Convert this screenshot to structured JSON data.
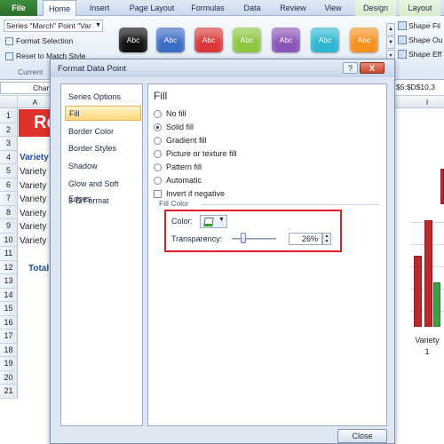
{
  "ribbon": {
    "tabs": [
      "File",
      "Home",
      "Insert",
      "Page Layout",
      "Formulas",
      "Data",
      "Review",
      "View",
      "Design",
      "Layout"
    ],
    "series_selector": "Series \"March\" Point \"Var",
    "format_selection": "Format Selection",
    "reset_to_match_style": "Reset to Match Style",
    "group_label": "Current",
    "style_swatches": [
      {
        "label": "Abc",
        "color": "#111111"
      },
      {
        "label": "Abc",
        "color": "#3b6cc4"
      },
      {
        "label": "Abc",
        "color": "#d9383a"
      },
      {
        "label": "Abc",
        "color": "#8cc63f"
      },
      {
        "label": "Abc",
        "color": "#8a55b8"
      },
      {
        "label": "Abc",
        "color": "#2eb6d0"
      },
      {
        "label": "Abc",
        "color": "#f4911e"
      }
    ],
    "shape_fill": "Shape Fil",
    "shape_outline": "Shape Ou",
    "shape_effects": "Shape Eff"
  },
  "formula_bar": {
    "name_box": "Char",
    "formula": "$5:$D$10,3"
  },
  "sheet": {
    "columns": [
      "A",
      "I"
    ],
    "rows": [
      "1",
      "2",
      "3",
      "4",
      "5",
      "6",
      "7",
      "8",
      "9",
      "10",
      "11",
      "12",
      "13",
      "14",
      "15",
      "16",
      "17",
      "18",
      "19",
      "20",
      "21"
    ],
    "title_cell": "Re",
    "header_cell": "Variety",
    "variety_cells": [
      "Variety",
      "Variety",
      "Variety",
      "Variety",
      "Variety",
      "Variety"
    ],
    "total_cell": "Total"
  },
  "chart": {
    "x_label": "Variety",
    "x_label_sub": "1",
    "series_colors": {
      "red": "#c0272d",
      "green": "#3aa04a"
    }
  },
  "dialog": {
    "title": "Format Data Point",
    "help": "?",
    "close_x": "X",
    "nav_items": [
      "Series Options",
      "Fill",
      "Border Color",
      "Border Styles",
      "Shadow",
      "Glow and Soft Edges",
      "3-D Format"
    ],
    "selected_nav": "Fill",
    "heading": "Fill",
    "fill_options": [
      {
        "label": "No fill",
        "selected": false
      },
      {
        "label": "Solid fill",
        "selected": true
      },
      {
        "label": "Gradient fill",
        "selected": false
      },
      {
        "label": "Picture or texture fill",
        "selected": false
      },
      {
        "label": "Pattern fill",
        "selected": false
      },
      {
        "label": "Automatic",
        "selected": false
      }
    ],
    "invert_if_negative": "Invert if negative",
    "fill_color_section": "Fill Color",
    "color_label": "Color:",
    "color_value": "#3a9a35",
    "transparency_label": "Transparency:",
    "transparency_value": "26%",
    "transparency_fraction": 0.26,
    "close_button": "Close"
  }
}
